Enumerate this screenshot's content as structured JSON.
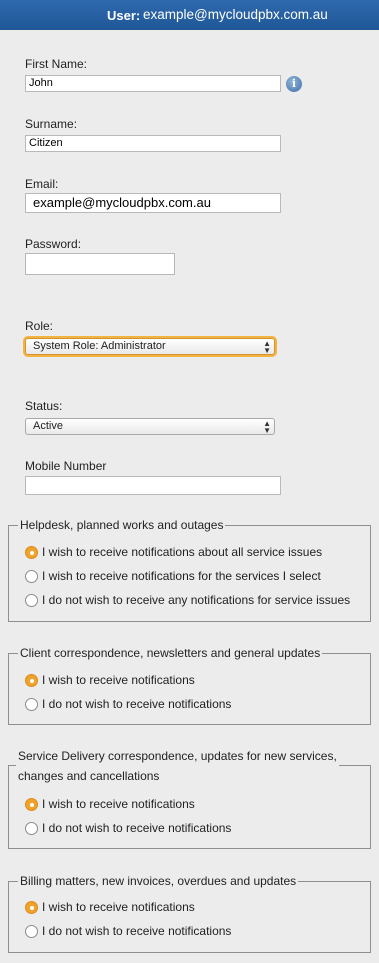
{
  "header": {
    "user_label": "User:",
    "user_email": "example@mycloudpbx.com.au"
  },
  "form": {
    "first_name": {
      "label": "First Name:",
      "value": "John"
    },
    "surname": {
      "label": "Surname:",
      "value": "Citizen"
    },
    "email": {
      "label": "Email:",
      "value": "example@mycloudpbx.com.au"
    },
    "password": {
      "label": "Password:",
      "value": ""
    },
    "role": {
      "label": "Role:",
      "value": "System Role: Administrator"
    },
    "status": {
      "label": "Status:",
      "value": "Active"
    },
    "mobile": {
      "label": "Mobile Number",
      "value": ""
    }
  },
  "groups": {
    "helpdesk": {
      "legend": "Helpdesk, planned works and outages",
      "options": [
        "I wish to receive notifications about all service issues",
        "I wish to receive notifications for the services I select",
        "I do not wish to receive any notifications for service issues"
      ],
      "selected": 0
    },
    "client": {
      "legend": "Client correspondence, newsletters and general updates",
      "options": [
        "I wish to receive notifications",
        "I do not wish to receive notifications"
      ],
      "selected": 0
    },
    "service": {
      "legend_line1": "Service Delivery correspondence, updates for new services,",
      "legend_line2": "changes and cancellations",
      "options": [
        "I wish to receive notifications",
        "I do not wish to receive notifications"
      ],
      "selected": 0
    },
    "billing": {
      "legend": "Billing matters, new invoices, overdues and updates",
      "options": [
        "I wish to receive notifications",
        "I do not wish to receive notifications"
      ],
      "selected": 0
    }
  },
  "colors": {
    "header": "#1f5797",
    "radio_checked": "#f0a22b",
    "focus_ring": "#f1b443"
  }
}
